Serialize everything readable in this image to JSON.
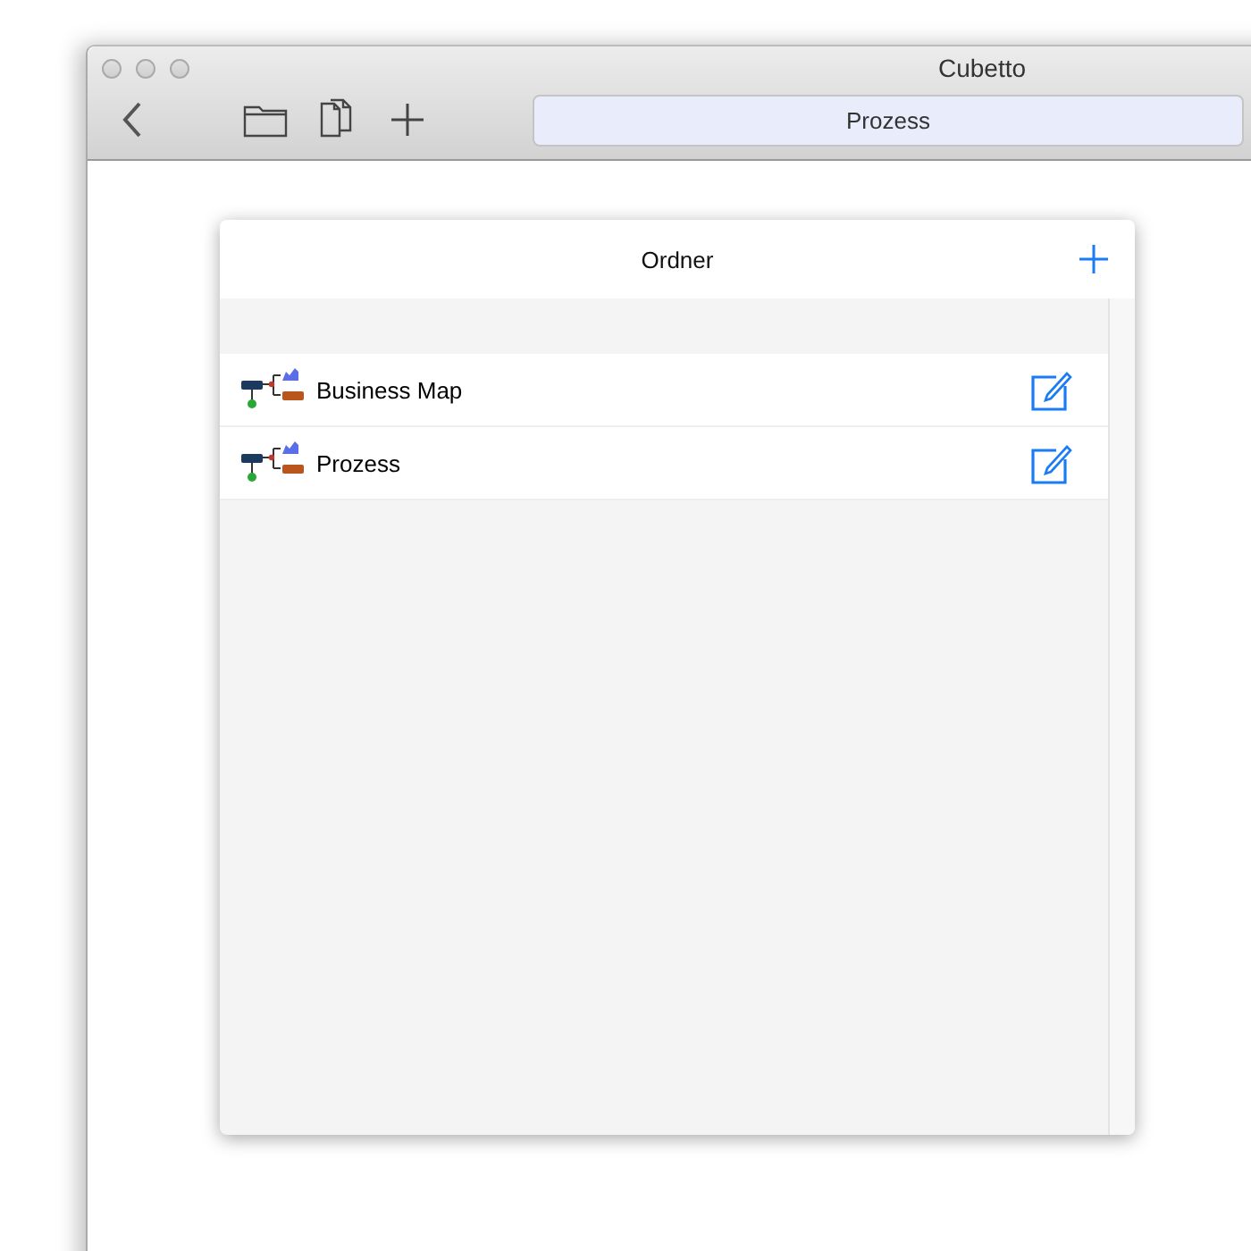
{
  "window": {
    "title": "Cubetto"
  },
  "toolbar": {
    "search": {
      "value": "Prozess"
    }
  },
  "panel": {
    "title": "Ordner",
    "items": [
      {
        "name": "Business Map"
      },
      {
        "name": "Prozess"
      }
    ]
  }
}
